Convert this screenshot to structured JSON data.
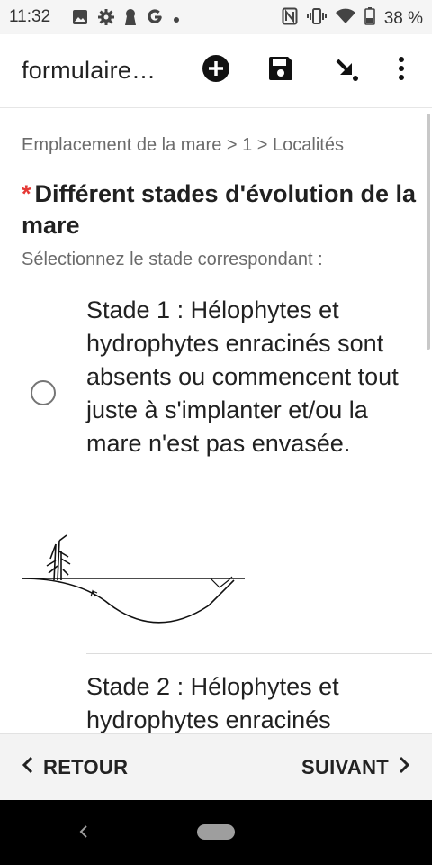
{
  "status_bar": {
    "time": "11:32",
    "battery": "38 %",
    "left_icons": [
      "image-icon",
      "gear-icon",
      "keyhole-icon",
      "google-icon",
      "dot-icon"
    ],
    "right_icons": [
      "nfc-icon",
      "vibrate-icon",
      "wifi-icon",
      "battery-icon"
    ]
  },
  "app_bar": {
    "title": "formulaire…",
    "actions": [
      "add-circle-icon",
      "save-icon",
      "download-arrow-icon",
      "more-vert-icon"
    ]
  },
  "content": {
    "breadcrumb": "Emplacement de la mare > 1 > Localités",
    "required_marker": "*",
    "question": "Différent stades d'évolution de la mare",
    "hint": "Sélectionnez le stade correspondant :",
    "choices": [
      {
        "label": "Stade 1 : Hélophytes et hydrophytes enracinés sont absents ou commencent tout juste à s'implanter et/ou la mare n'est pas envasée.",
        "selected": false
      },
      {
        "label": "Stade 2 : Hélophytes et hydrophytes enracinés"
      }
    ]
  },
  "bottom_nav": {
    "back_label": "RETOUR",
    "next_label": "SUIVANT"
  },
  "colors": {
    "required": "#e53935",
    "text": "#212121",
    "secondary_text": "#6b6b6b",
    "bottom_bar": "#f3f3f3",
    "system_nav": "#000000"
  }
}
